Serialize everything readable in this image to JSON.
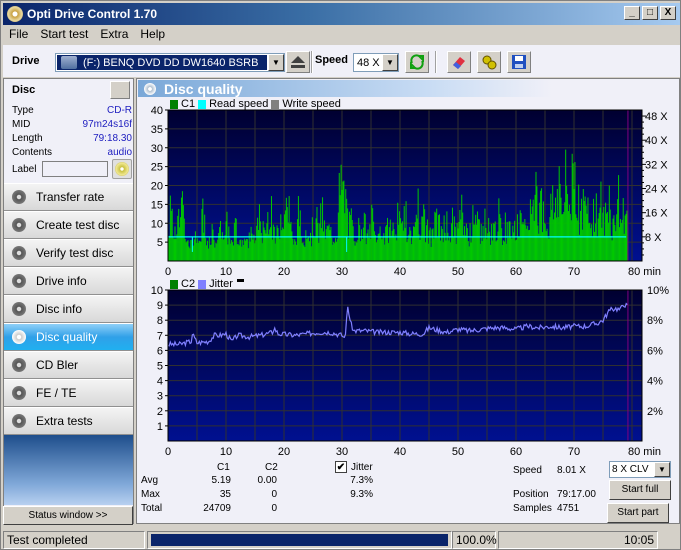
{
  "window": {
    "title": "Opti Drive Control 1.70",
    "controls": [
      "_",
      "□",
      "X"
    ]
  },
  "menu": [
    "File",
    "Start test",
    "Extra",
    "Help"
  ],
  "toolbar": {
    "drive_label": "Drive",
    "drive_value": "(F:)   BENQ DVD DD DW1640 BSRB",
    "speed_label": "Speed",
    "speed_value": "48 X",
    "icons": [
      "eject-icon",
      "refresh-icon",
      "erase-icon",
      "settings-icon",
      "save-icon"
    ]
  },
  "disc": {
    "header": "Disc",
    "fields": [
      {
        "key": "Type",
        "value": "CD-R"
      },
      {
        "key": "MID",
        "value": "97m24s16f"
      },
      {
        "key": "Length",
        "value": "79:18.30"
      },
      {
        "key": "Contents",
        "value": "audio"
      }
    ],
    "label_key": "Label",
    "label_value": ""
  },
  "nav": [
    {
      "label": "Transfer rate",
      "active": false
    },
    {
      "label": "Create test disc",
      "active": false
    },
    {
      "label": "Verify test disc",
      "active": false
    },
    {
      "label": "Drive info",
      "active": false
    },
    {
      "label": "Disc info",
      "active": false
    },
    {
      "label": "Disc quality",
      "active": true
    },
    {
      "label": "CD Bler",
      "active": false
    },
    {
      "label": "FE / TE",
      "active": false
    },
    {
      "label": "Extra tests",
      "active": false
    }
  ],
  "status_window_label": "Status window >>",
  "panel_title": "Disc quality",
  "colors": {
    "plot_bg_top": "#000030",
    "plot_bg_bottom": "#001090",
    "c1": "#00c800",
    "read_speed": "#00ffff",
    "write_speed": "#808080",
    "jitter": "#8080ff",
    "c2": "#008000",
    "grid": "#303030",
    "end_marker": "#800080"
  },
  "chart_data": [
    {
      "type": "bar",
      "title": "C1 / Read speed",
      "legend": [
        "C1",
        "Read speed",
        "Write speed"
      ],
      "xlabel": "min",
      "x_ticks": [
        0,
        10,
        20,
        30,
        40,
        50,
        60,
        70,
        80
      ],
      "x_tick_labels": [
        "0",
        "10",
        "20",
        "30",
        "40",
        "50",
        "60",
        "70",
        "80 min"
      ],
      "xlim": [
        0,
        80
      ],
      "ylim": [
        0,
        40
      ],
      "y_ticks": [
        5,
        10,
        15,
        20,
        25,
        30,
        35,
        40
      ],
      "y2_ticks": [
        "8 X",
        "16 X",
        "24 X",
        "32 X",
        "40 X",
        "48 X"
      ],
      "y2lim": [
        0,
        50
      ],
      "c1_profile": [
        [
          0,
          9
        ],
        [
          0.5,
          22
        ],
        [
          1,
          7
        ],
        [
          1.5,
          16
        ],
        [
          2,
          12
        ],
        [
          2.5,
          22
        ],
        [
          3,
          5
        ],
        [
          3.5,
          6
        ],
        [
          4,
          5
        ],
        [
          4.5,
          12
        ],
        [
          5,
          3
        ],
        [
          5.5,
          6
        ],
        [
          6,
          21
        ],
        [
          6.5,
          6
        ],
        [
          7,
          8
        ],
        [
          7.5,
          12
        ],
        [
          8,
          7
        ],
        [
          8.5,
          6
        ],
        [
          9,
          11
        ],
        [
          9.5,
          5
        ],
        [
          10,
          14
        ],
        [
          10.5,
          8
        ],
        [
          11,
          5
        ],
        [
          11.5,
          13
        ],
        [
          12,
          8
        ],
        [
          12.5,
          6
        ],
        [
          13,
          12
        ],
        [
          13.5,
          5
        ],
        [
          14,
          10
        ],
        [
          14.5,
          8
        ],
        [
          15,
          6
        ],
        [
          15.5,
          19
        ],
        [
          16,
          8
        ],
        [
          16.5,
          12
        ],
        [
          17,
          14
        ],
        [
          17.5,
          25
        ],
        [
          18,
          10
        ],
        [
          18.5,
          8
        ],
        [
          19,
          12
        ],
        [
          19.5,
          20
        ],
        [
          20,
          20
        ],
        [
          20.5,
          22
        ],
        [
          21,
          14
        ],
        [
          21.5,
          6
        ],
        [
          22,
          8
        ],
        [
          22.5,
          20
        ],
        [
          23,
          7
        ],
        [
          23.5,
          6
        ],
        [
          24,
          12
        ],
        [
          24.5,
          8
        ],
        [
          25,
          14
        ],
        [
          25.5,
          16
        ],
        [
          26,
          10
        ],
        [
          26.5,
          21
        ],
        [
          27,
          8
        ],
        [
          27.5,
          13
        ],
        [
          28,
          9
        ],
        [
          28.5,
          10
        ],
        [
          29,
          11
        ],
        [
          29.5,
          25
        ],
        [
          30,
          29
        ],
        [
          30.5,
          20
        ],
        [
          31,
          12
        ],
        [
          31.5,
          15
        ],
        [
          32,
          8
        ],
        [
          32.5,
          14
        ],
        [
          33,
          11
        ],
        [
          33.5,
          16
        ],
        [
          34,
          12
        ],
        [
          34.5,
          8
        ],
        [
          35,
          16
        ],
        [
          35.5,
          11
        ],
        [
          36,
          7
        ],
        [
          36.5,
          13
        ],
        [
          37,
          10
        ],
        [
          37.5,
          9
        ],
        [
          38,
          14
        ],
        [
          38.5,
          12
        ],
        [
          39,
          12
        ],
        [
          39.5,
          16
        ],
        [
          40,
          12
        ],
        [
          40.5,
          14
        ],
        [
          41,
          16
        ],
        [
          41.5,
          8
        ],
        [
          42,
          13
        ],
        [
          42.5,
          9
        ],
        [
          43,
          20
        ],
        [
          43.5,
          10
        ],
        [
          44,
          15
        ],
        [
          44.5,
          11
        ],
        [
          45,
          12
        ],
        [
          45.5,
          8
        ],
        [
          46,
          14
        ],
        [
          46.5,
          15
        ],
        [
          47,
          9
        ],
        [
          47.5,
          12
        ],
        [
          48,
          14
        ],
        [
          48.5,
          6
        ],
        [
          49,
          17
        ],
        [
          49.5,
          8
        ],
        [
          50,
          12
        ],
        [
          50.5,
          20
        ],
        [
          51,
          9
        ],
        [
          51.5,
          12
        ],
        [
          52,
          10
        ],
        [
          52.5,
          15
        ],
        [
          53,
          12
        ],
        [
          53.5,
          14
        ],
        [
          54,
          9
        ],
        [
          54.5,
          15
        ],
        [
          55,
          11
        ],
        [
          55.5,
          12
        ],
        [
          56,
          10
        ],
        [
          56.5,
          14
        ],
        [
          57,
          17
        ],
        [
          57.5,
          8
        ],
        [
          58,
          13
        ],
        [
          58.5,
          12
        ],
        [
          59,
          10
        ],
        [
          59.5,
          15
        ],
        [
          60,
          12
        ],
        [
          60.5,
          14
        ],
        [
          61,
          12
        ],
        [
          61.5,
          11
        ],
        [
          62,
          9
        ],
        [
          62.5,
          23
        ],
        [
          63,
          20
        ],
        [
          63.5,
          25
        ],
        [
          64,
          17
        ],
        [
          64.5,
          22
        ],
        [
          65,
          16
        ],
        [
          65.5,
          12
        ],
        [
          66,
          22
        ],
        [
          66.5,
          18
        ],
        [
          67,
          28
        ],
        [
          67.5,
          24
        ],
        [
          68,
          18
        ],
        [
          68.5,
          30
        ],
        [
          69,
          20
        ],
        [
          69.5,
          26
        ],
        [
          70,
          38
        ],
        [
          70.5,
          22
        ],
        [
          71,
          18
        ],
        [
          71.5,
          20
        ],
        [
          72,
          22
        ],
        [
          72.5,
          14
        ],
        [
          73,
          18
        ],
        [
          73.5,
          20
        ],
        [
          74,
          16
        ],
        [
          74.5,
          22
        ],
        [
          75,
          14
        ],
        [
          75.5,
          18
        ],
        [
          76,
          20
        ],
        [
          76.5,
          12
        ],
        [
          77,
          16
        ],
        [
          77.5,
          26
        ],
        [
          78,
          14
        ],
        [
          78.5,
          20
        ],
        [
          79,
          16
        ],
        [
          79.3,
          12
        ]
      ],
      "read_speed_x": 8.0,
      "read_speed_dips": [
        [
          4.2,
          3
        ],
        [
          30.8,
          3
        ]
      ],
      "end_min": 79.3
    },
    {
      "type": "line",
      "title": "C2 / Jitter",
      "legend": [
        "C2",
        "Jitter"
      ],
      "xlabel": "min",
      "x_ticks": [
        0,
        10,
        20,
        30,
        40,
        50,
        60,
        70,
        80
      ],
      "x_tick_labels": [
        "0",
        "10",
        "20",
        "30",
        "40",
        "50",
        "60",
        "70",
        "80 min"
      ],
      "xlim": [
        0,
        80
      ],
      "ylim": [
        0,
        10
      ],
      "y_ticks": [
        1,
        2,
        3,
        4,
        5,
        6,
        7,
        8,
        9,
        10
      ],
      "y2_ticks": [
        "2%",
        "4%",
        "6%",
        "8%",
        "10%"
      ],
      "c2_values": "all 0",
      "jitter_profile_pct": [
        [
          0,
          6.4
        ],
        [
          2,
          6.4
        ],
        [
          4,
          6.6
        ],
        [
          4.2,
          7.1
        ],
        [
          5,
          6.5
        ],
        [
          7,
          6.6
        ],
        [
          8,
          7.0
        ],
        [
          9,
          7.0
        ],
        [
          10,
          7.1
        ],
        [
          11,
          6.6
        ],
        [
          12,
          7.0
        ],
        [
          14,
          6.9
        ],
        [
          16,
          7.0
        ],
        [
          18,
          7.2
        ],
        [
          18.3,
          7.5
        ],
        [
          19,
          7.1
        ],
        [
          22,
          7.0
        ],
        [
          24,
          7.1
        ],
        [
          26,
          7.2
        ],
        [
          28,
          7.2
        ],
        [
          30,
          7.0
        ],
        [
          30.5,
          6.8
        ],
        [
          31,
          8.9
        ],
        [
          31.5,
          7.8
        ],
        [
          32,
          7.3
        ],
        [
          34,
          7.3
        ],
        [
          36,
          7.2
        ],
        [
          38,
          7.2
        ],
        [
          40,
          7.2
        ],
        [
          42,
          7.1
        ],
        [
          44,
          7.1
        ],
        [
          45,
          7.5
        ],
        [
          46,
          7.4
        ],
        [
          48,
          7.2
        ],
        [
          50,
          7.4
        ],
        [
          52,
          7.3
        ],
        [
          54,
          7.4
        ],
        [
          56,
          7.5
        ],
        [
          58,
          7.5
        ],
        [
          60,
          7.4
        ],
        [
          62,
          7.6
        ],
        [
          64,
          7.5
        ],
        [
          66,
          7.6
        ],
        [
          68,
          7.5
        ],
        [
          70,
          7.6
        ],
        [
          72,
          7.6
        ],
        [
          74,
          7.8
        ],
        [
          75,
          8.0
        ],
        [
          76,
          8.6
        ],
        [
          77,
          8.8
        ],
        [
          78,
          8.7
        ],
        [
          78.5,
          9.1
        ],
        [
          79.3,
          8.9
        ]
      ],
      "end_min": 79.3
    }
  ],
  "stats": {
    "col_c1": "C1",
    "col_c2": "C2",
    "jitter_label": "Jitter",
    "jitter_checked": true,
    "rows": [
      {
        "label": "Avg",
        "c1": "5.19",
        "c2": "0.00",
        "jitter": "7.3%"
      },
      {
        "label": "Max",
        "c1": "35",
        "c2": "0",
        "jitter": "9.3%"
      },
      {
        "label": "Total",
        "c1": "24709",
        "c2": "0",
        "jitter": ""
      }
    ]
  },
  "run": {
    "speed_label": "Speed",
    "speed_value": "8.01 X",
    "position_label": "Position",
    "position_value": "79:17.00",
    "samples_label": "Samples",
    "samples_value": "4751",
    "mode_value": "8 X CLV",
    "start_full": "Start full",
    "start_part": "Start part"
  },
  "statusbar": {
    "message": "Test completed",
    "progress_pct": 100,
    "progress_label": "100.0%",
    "time": "10:05"
  }
}
